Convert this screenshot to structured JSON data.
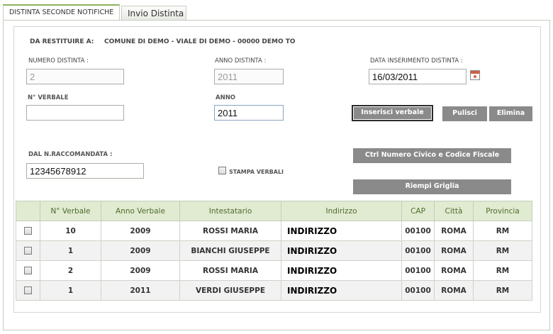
{
  "tabs": [
    {
      "label": "DISTINTA SECONDE NOTIFICHE"
    },
    {
      "label": "Invio Distinta"
    }
  ],
  "form": {
    "restituire_label": "DA RESTITUIRE A:",
    "restituire_value": "COMUNE DI DEMO - VIALE DI DEMO - 00000 DEMO TO",
    "numero_distinta_label": "NUMERO DISTINTA :",
    "numero_distinta_value": "2",
    "anno_distinta_label": "ANNO DISTINTA :",
    "anno_distinta_value": "2011",
    "data_inserimento_label": "DATA INSERIMENTO DISTINTA :",
    "data_inserimento_value": "16/03/2011",
    "verbale_label": "N° VERBALE",
    "verbale_value": "",
    "anno_label": "ANNO",
    "anno_value": "2011",
    "raccomandata_label": "DAL N.RACCOMANDATA :",
    "raccomandata_value": "12345678912",
    "stampa_label": "STAMPA VERBALI"
  },
  "buttons": {
    "inserisci": "Inserisci verbale",
    "pulisci": "Pulisci",
    "elimina": "Elimina",
    "ctrl": "Ctrl Numero Civico e Codice Fiscale",
    "riempi": "Riempi Griglia"
  },
  "grid": {
    "headers": [
      "",
      "N° Verbale",
      "Anno Verbale",
      "Intestatario",
      "Indirizzo",
      "CAP",
      "Città",
      "Provincia"
    ],
    "rows": [
      {
        "verbale": "10",
        "anno": "2009",
        "intestatario": "ROSSI MARIA",
        "indirizzo": "INDIRIZZO",
        "cap": "00100",
        "citta": "ROMA",
        "provincia": "RM"
      },
      {
        "verbale": "1",
        "anno": "2009",
        "intestatario": "BIANCHI GIUSEPPE",
        "indirizzo": "INDIRIZZO",
        "cap": "00100",
        "citta": "ROMA",
        "provincia": "RM"
      },
      {
        "verbale": "2",
        "anno": "2009",
        "intestatario": "ROSSI MARIA",
        "indirizzo": "INDIRIZZO",
        "cap": "00100",
        "citta": "ROMA",
        "provincia": "RM"
      },
      {
        "verbale": "1",
        "anno": "2011",
        "intestatario": "VERDI GIUSEPPE",
        "indirizzo": "INDIRIZZO",
        "cap": "00100",
        "citta": "ROMA",
        "provincia": "RM"
      }
    ]
  },
  "icons": {
    "calendar": "calendar-icon",
    "checkbox": "checkbox-icon"
  },
  "colors": {
    "accent_green": "#8fb05c",
    "header_bg": "#e1ebd1",
    "button_gray": "#8a8a8a"
  }
}
